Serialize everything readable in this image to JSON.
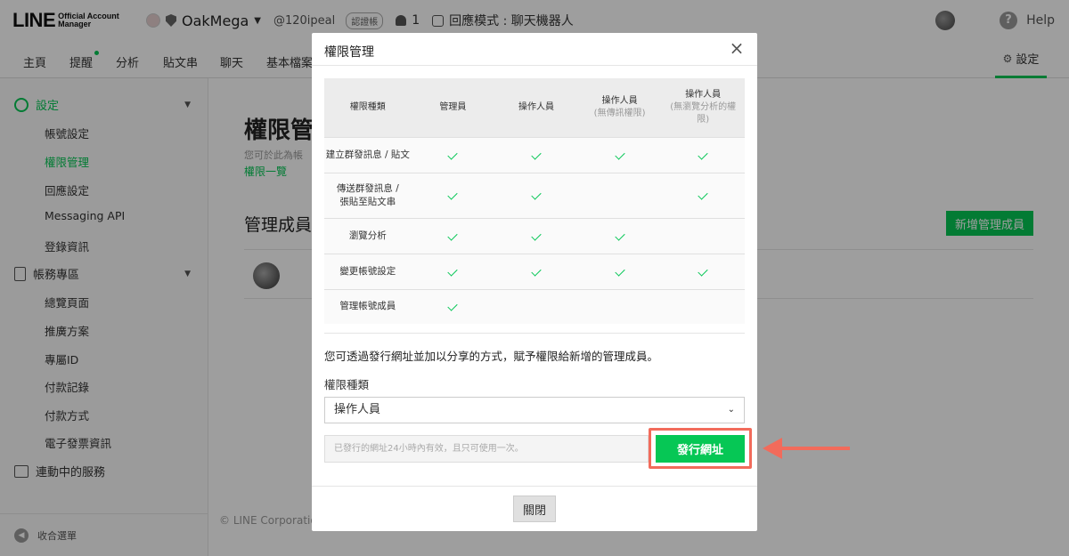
{
  "header": {
    "logo_line": "LINE",
    "logo_sub": "Official Account Manager",
    "account_name": "OakMega",
    "account_id": "@120ipeal",
    "badge": "認證帳",
    "member_count": "1",
    "mode": "回應模式 : 聊天機器人",
    "help": "Help"
  },
  "nav": {
    "items": [
      "主頁",
      "提醒",
      "分析",
      "貼文串",
      "聊天",
      "基本檔案"
    ],
    "settings": "設定"
  },
  "sidebar": {
    "settings_group": "設定",
    "settings_items": [
      "帳號設定",
      "權限管理",
      "回應設定",
      "Messaging API",
      "登錄資訊"
    ],
    "account_group": "帳務專區",
    "account_items": [
      "總覽頁面",
      "推廣方案",
      "專屬ID",
      "付款記錄",
      "付款方式",
      "電子發票資訊"
    ],
    "services_group": "連動中的服務",
    "collapse": "收合選單"
  },
  "main": {
    "title": "權限管",
    "desc": "您可於此為帳",
    "link": "權限一覽",
    "section": "管理成員",
    "add_button": "新增管理成員",
    "copyright": "© LINE Corporation"
  },
  "modal": {
    "title": "權限管理",
    "close_icon": "×",
    "table": {
      "headers": [
        {
          "main": "權限種類",
          "sub": ""
        },
        {
          "main": "管理員",
          "sub": ""
        },
        {
          "main": "操作人員",
          "sub": ""
        },
        {
          "main": "操作人員",
          "sub": "(無傳訊權限)"
        },
        {
          "main": "操作人員",
          "sub": "(無瀏覽分析的權限)"
        }
      ],
      "rows": [
        {
          "label": "建立群發訊息 / 貼文",
          "checks": [
            true,
            true,
            true,
            true
          ]
        },
        {
          "label": "傳送群發訊息 / 張貼至貼文串",
          "checks": [
            true,
            true,
            false,
            true
          ]
        },
        {
          "label": "瀏覽分析",
          "checks": [
            true,
            true,
            true,
            false
          ]
        },
        {
          "label": "變更帳號設定",
          "checks": [
            true,
            true,
            true,
            true
          ]
        },
        {
          "label": "管理帳號成員",
          "checks": [
            true,
            false,
            false,
            false
          ]
        }
      ]
    },
    "hint": "您可透過發行網址並加以分享的方式，賦予權限給新增的管理成員。",
    "type_label": "權限種類",
    "select_value": "操作人員",
    "url_placeholder": "已發行的網址24小時內有效，且只可使用一次。",
    "issue_button": "發行網址",
    "close_button": "關閉"
  },
  "colors": {
    "accent": "#06c755",
    "highlight": "#f26b5b"
  }
}
